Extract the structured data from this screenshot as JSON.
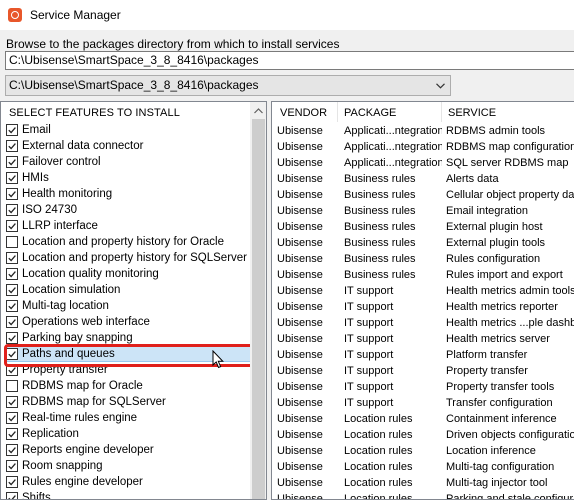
{
  "window": {
    "title": "Service Manager",
    "icon": "service-manager-app-icon"
  },
  "browse": {
    "label": "Browse to the packages directory from which to install services",
    "path_value": "C:\\Ubisense\\SmartSpace_3_8_8416\\packages",
    "combo_value": "C:\\Ubisense\\SmartSpace_3_8_8416\\packages"
  },
  "features": {
    "header": "SELECT FEATURES TO INSTALL",
    "items": [
      {
        "label": "Email",
        "checked": true
      },
      {
        "label": "External data connector",
        "checked": true
      },
      {
        "label": "Failover control",
        "checked": true
      },
      {
        "label": "HMIs",
        "checked": true
      },
      {
        "label": "Health monitoring",
        "checked": true
      },
      {
        "label": "ISO 24730",
        "checked": true
      },
      {
        "label": "LLRP interface",
        "checked": true
      },
      {
        "label": "Location and property history for Oracle",
        "checked": false
      },
      {
        "label": "Location and property history for SQLServer",
        "checked": true
      },
      {
        "label": "Location quality monitoring",
        "checked": true
      },
      {
        "label": "Location simulation",
        "checked": true
      },
      {
        "label": "Multi-tag location",
        "checked": true
      },
      {
        "label": "Operations web interface",
        "checked": true
      },
      {
        "label": "Parking bay snapping",
        "checked": true
      },
      {
        "label": "Paths and queues",
        "checked": true,
        "selected": true
      },
      {
        "label": "Property transfer",
        "checked": true
      },
      {
        "label": "RDBMS map for Oracle",
        "checked": false
      },
      {
        "label": "RDBMS map for SQLServer",
        "checked": true
      },
      {
        "label": "Real-time rules engine",
        "checked": true
      },
      {
        "label": "Replication",
        "checked": true
      },
      {
        "label": "Reports engine developer",
        "checked": true
      },
      {
        "label": "Room snapping",
        "checked": true
      },
      {
        "label": "Rules engine developer",
        "checked": true
      },
      {
        "label": "Shifts",
        "checked": true
      }
    ]
  },
  "services": {
    "columns": [
      "VENDOR",
      "PACKAGE",
      "SERVICE"
    ],
    "rows": [
      [
        "Ubisense",
        "Applicati...ntegration",
        "RDBMS admin tools"
      ],
      [
        "Ubisense",
        "Applicati...ntegration",
        "RDBMS map configuration"
      ],
      [
        "Ubisense",
        "Applicati...ntegration",
        "SQL server RDBMS map"
      ],
      [
        "Ubisense",
        "Business rules",
        "Alerts data"
      ],
      [
        "Ubisense",
        "Business rules",
        "Cellular object property data"
      ],
      [
        "Ubisense",
        "Business rules",
        "Email integration"
      ],
      [
        "Ubisense",
        "Business rules",
        "External plugin host"
      ],
      [
        "Ubisense",
        "Business rules",
        "External plugin tools"
      ],
      [
        "Ubisense",
        "Business rules",
        "Rules configuration"
      ],
      [
        "Ubisense",
        "Business rules",
        "Rules import and export"
      ],
      [
        "Ubisense",
        "IT support",
        "Health metrics admin tools"
      ],
      [
        "Ubisense",
        "IT support",
        "Health metrics reporter"
      ],
      [
        "Ubisense",
        "IT support",
        "Health metrics ...ple dashboard"
      ],
      [
        "Ubisense",
        "IT support",
        "Health metrics server"
      ],
      [
        "Ubisense",
        "IT support",
        "Platform transfer"
      ],
      [
        "Ubisense",
        "IT support",
        "Property transfer"
      ],
      [
        "Ubisense",
        "IT support",
        "Property transfer tools"
      ],
      [
        "Ubisense",
        "IT support",
        "Transfer configuration"
      ],
      [
        "Ubisense",
        "Location rules",
        "Containment inference"
      ],
      [
        "Ubisense",
        "Location rules",
        "Driven objects configuration"
      ],
      [
        "Ubisense",
        "Location rules",
        "Location inference"
      ],
      [
        "Ubisense",
        "Location rules",
        "Multi-tag configuration"
      ],
      [
        "Ubisense",
        "Location rules",
        "Multi-tag injector tool"
      ],
      [
        "Ubisense",
        "Location rules",
        "Parking and stale configuration"
      ]
    ]
  }
}
